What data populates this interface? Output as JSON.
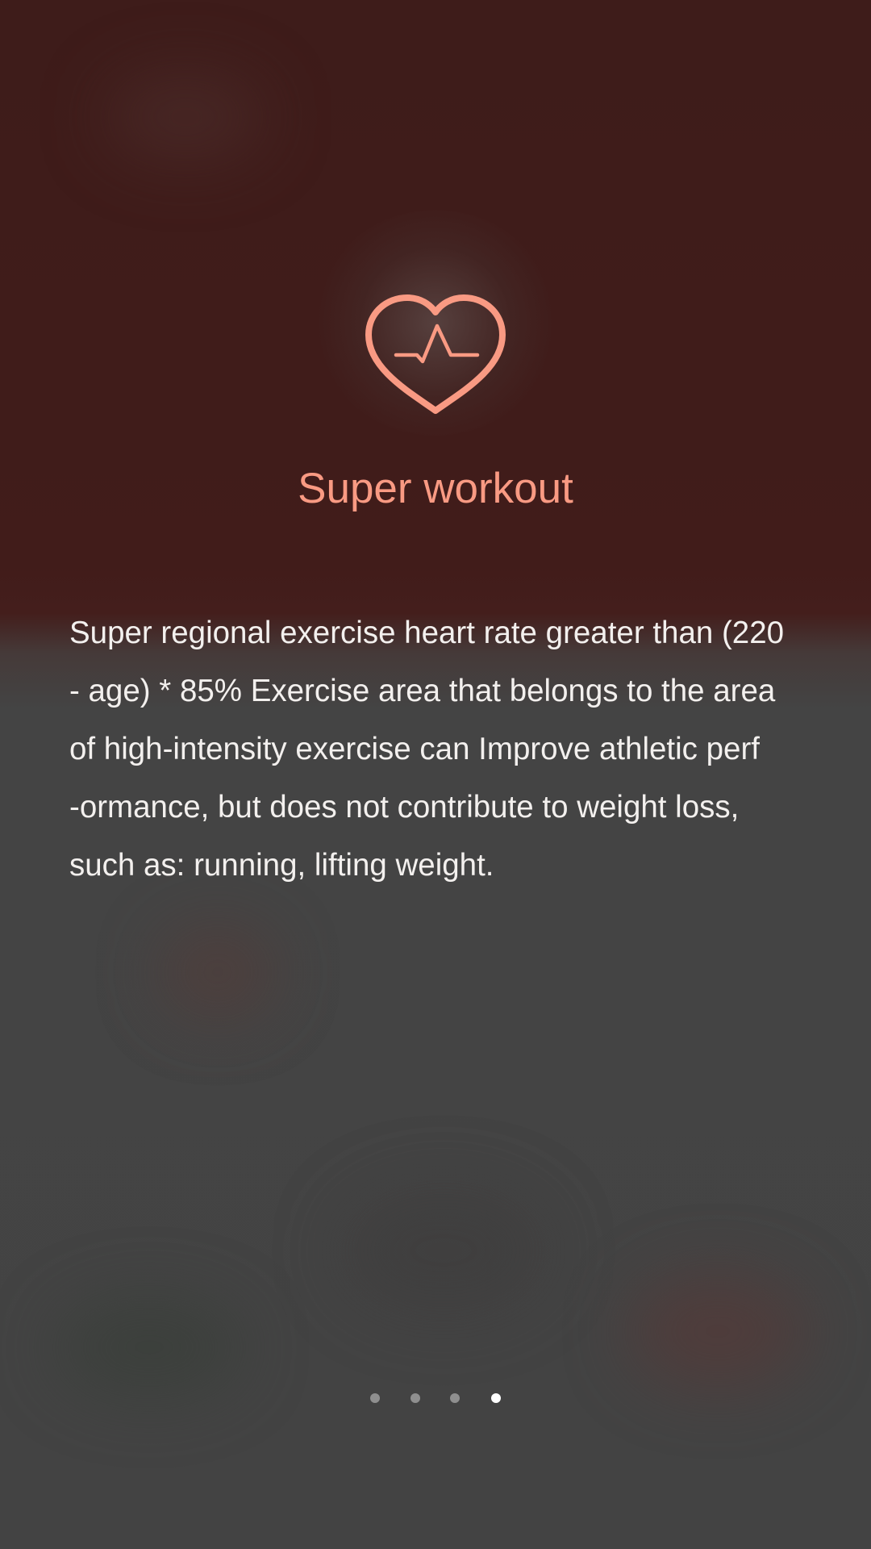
{
  "onboarding": {
    "icon": "heart-rate-icon",
    "accent_color": "#f99a83",
    "title": "Super workout",
    "description": "Super regional exercise heart rate greater than (220\n- age) * 85%  Exercise area that belongs to the area\nof high-intensity exercise can Improve athletic perf\n-ormance, but does not contribute to weight loss,\nsuch as: running, lifting weight."
  },
  "pager": {
    "page_count": 4,
    "current_page": 4
  }
}
